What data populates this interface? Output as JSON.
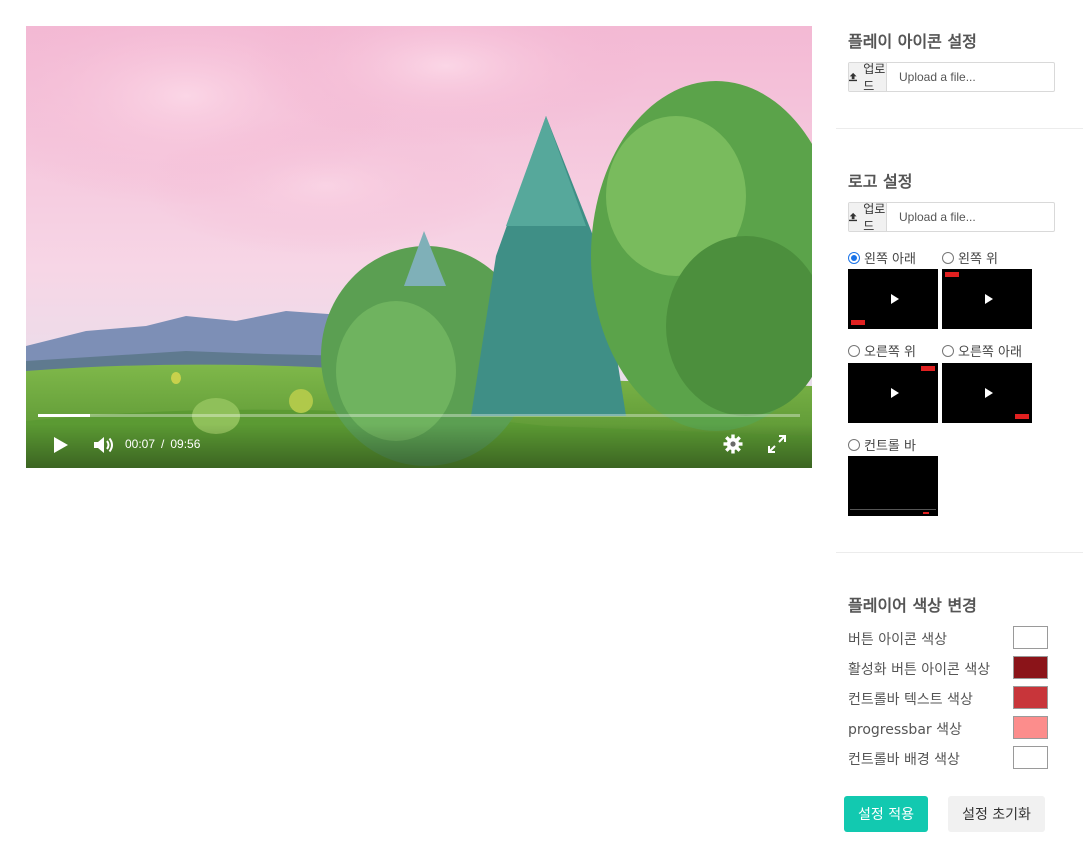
{
  "player": {
    "current_time": "00:07",
    "time_separator": "/",
    "duration": "09:56",
    "progress_fraction": 0.068
  },
  "play_icon_section": {
    "title": "플레이 아이콘 설정",
    "upload_label": "업로드",
    "file_placeholder": "Upload a file..."
  },
  "logo_section": {
    "title": "로고 설정",
    "upload_label": "업로드",
    "file_placeholder": "Upload a file...",
    "positions": [
      {
        "label": "왼쪽 아래",
        "checked": true
      },
      {
        "label": "왼쪽 위",
        "checked": false
      },
      {
        "label": "오른쪽 위",
        "checked": false
      },
      {
        "label": "오른쪽 아래",
        "checked": false
      },
      {
        "label": "컨트롤 바",
        "checked": false
      }
    ]
  },
  "color_section": {
    "title": "플레이어 색상 변경",
    "rows": [
      {
        "label": "버튼 아이콘 색상",
        "color": "#ffffff"
      },
      {
        "label": "활성화 버튼 아이콘 색상",
        "color": "#8b1419"
      },
      {
        "label": "컨트롤바 텍스트 색상",
        "color": "#c8353a"
      },
      {
        "label": "progressbar 색상",
        "color": "#fc8d8c"
      },
      {
        "label": "컨트롤바 배경 색상",
        "color": "#ffffff"
      }
    ]
  },
  "actions": {
    "apply_label": "설정 적용",
    "reset_label": "설정 초기화"
  },
  "colors": {
    "apply_button": "#12c9b0",
    "logo_marker": "#e02020"
  }
}
